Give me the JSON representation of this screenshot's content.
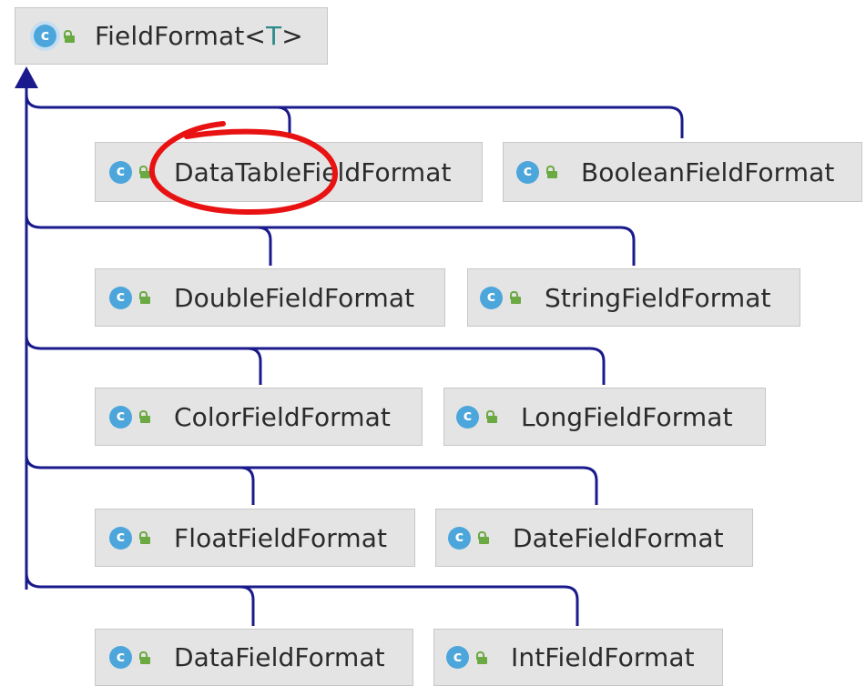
{
  "root": {
    "name": "FieldFormat",
    "type_param_open": "<",
    "type_param": "T",
    "type_param_close": ">"
  },
  "children": [
    {
      "name": "DataTableFieldFormat"
    },
    {
      "name": "BooleanFieldFormat"
    },
    {
      "name": "DoubleFieldFormat"
    },
    {
      "name": "StringFieldFormat"
    },
    {
      "name": "ColorFieldFormat"
    },
    {
      "name": "LongFieldFormat"
    },
    {
      "name": "FloatFieldFormat"
    },
    {
      "name": "DateFieldFormat"
    },
    {
      "name": "DataFieldFormat"
    },
    {
      "name": "IntFieldFormat"
    }
  ],
  "colors": {
    "edge": "#1a1a8c",
    "annotation": "#e81212",
    "node_fill": "#e4e4e4",
    "class_icon": "#4ca6db",
    "lock_icon": "#6ba943",
    "type_param": "#2d8a8a"
  },
  "highlighted": "DataTableFieldFormat"
}
